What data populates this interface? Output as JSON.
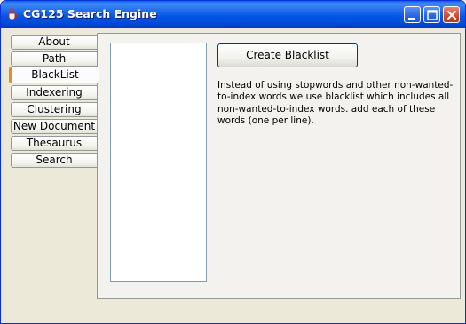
{
  "window": {
    "title": "CG125 Search Engine"
  },
  "tabs": [
    {
      "label": "About",
      "selected": false
    },
    {
      "label": "Path",
      "selected": false
    },
    {
      "label": "BlackList",
      "selected": true
    },
    {
      "label": "Indexering",
      "selected": false
    },
    {
      "label": "Clustering",
      "selected": false
    },
    {
      "label": "New Document",
      "selected": false
    },
    {
      "label": "Thesaurus",
      "selected": false
    },
    {
      "label": "Search",
      "selected": false
    }
  ],
  "blacklist_panel": {
    "words_text": "",
    "create_button_label": "Create Blacklist",
    "description": "Instead of using stopwords and other non-wanted-to-index words we use blacklist which includes all non-wanted-to-index words. add each of these words (one per line)."
  },
  "icons": {
    "app": "java-cup-icon",
    "minimize": "minimize-icon",
    "maximize": "maximize-icon",
    "close": "close-icon"
  },
  "colors": {
    "titlebar": "#0055e5",
    "selected_tab_accent": "#e68b2c",
    "close_button": "#d24a2a"
  }
}
